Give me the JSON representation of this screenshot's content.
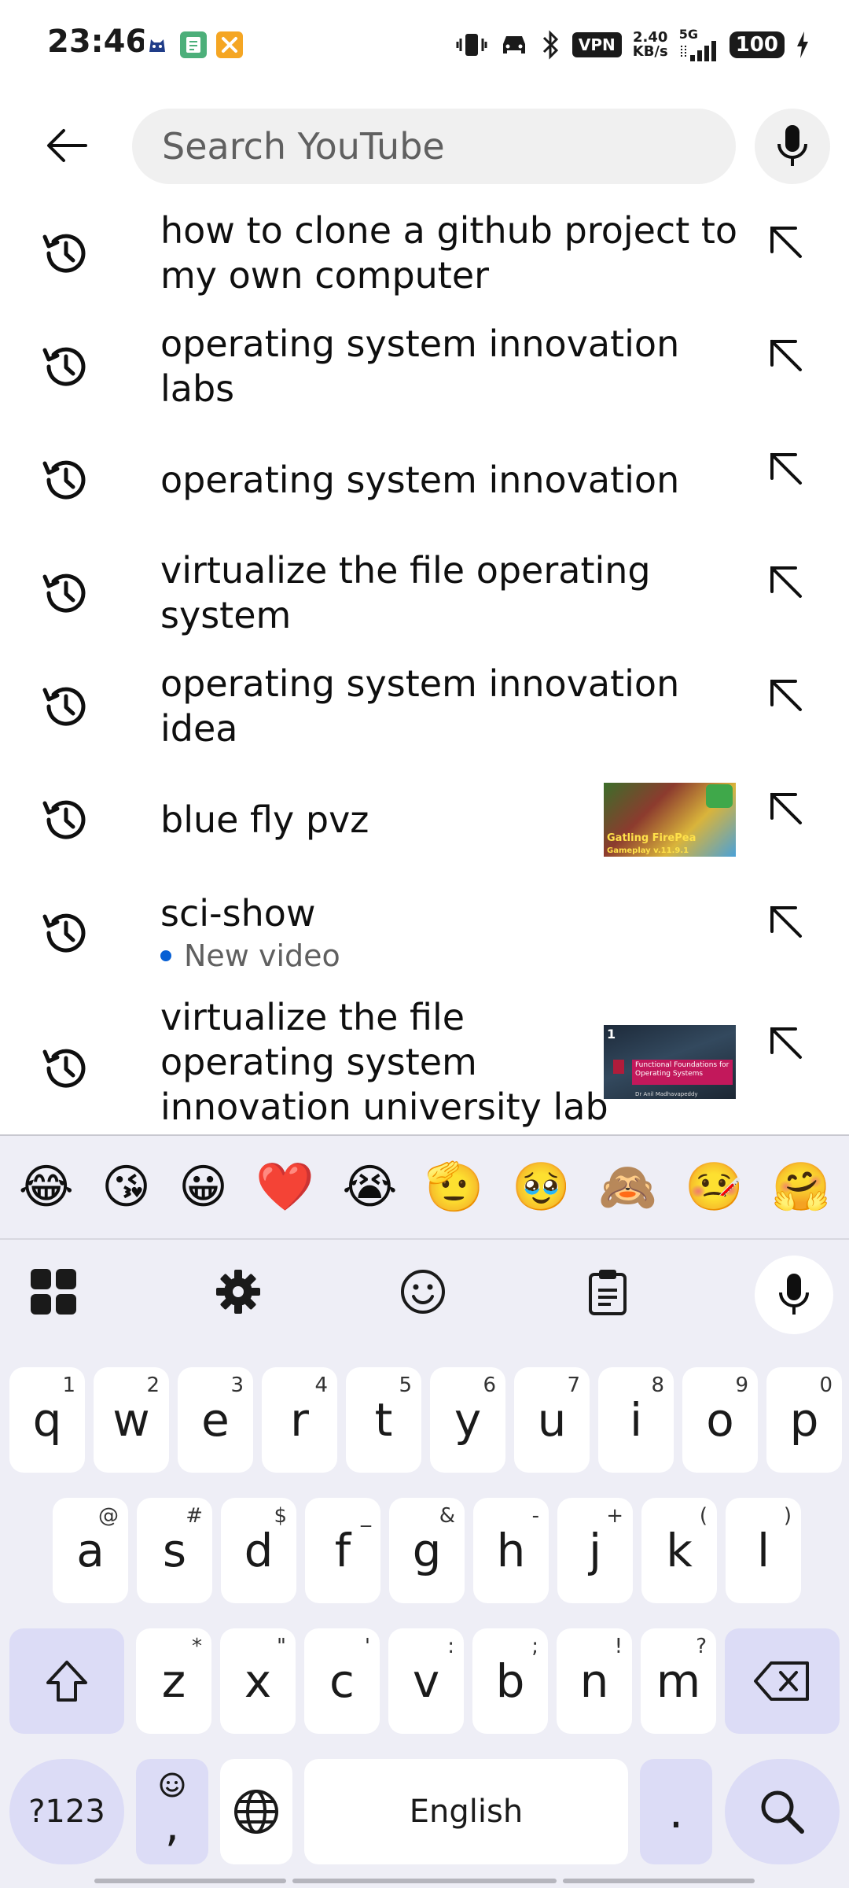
{
  "status_bar": {
    "time": "23:46",
    "vpn": "VPN",
    "speed_value": "2.40",
    "speed_unit": "KB/s",
    "network": "5G",
    "battery": "100"
  },
  "search": {
    "placeholder": "Search YouTube",
    "value": ""
  },
  "suggestions": [
    {
      "line1": "how to clone a github project to",
      "line2": "my own computer"
    },
    {
      "line1": "operating system innovation",
      "line2": "labs"
    },
    {
      "line1": "operating system innovation",
      "line2": ""
    },
    {
      "line1": "virtualize the file operating",
      "line2": "system"
    },
    {
      "line1": "operating system innovation",
      "line2": "idea"
    },
    {
      "line1": "blue fly pvz",
      "line2": "",
      "thumb_text": "Gatling FirePea",
      "thumb_sub": "Gameplay v.11.9.1"
    },
    {
      "line1": "sci-show",
      "line2": "",
      "sub_label": "New video"
    },
    {
      "line1": "virtualize the file",
      "line2": "operating system",
      "line3": "innovation university lab",
      "thumb_text": "Functional Foundations for Operating Systems",
      "thumb_sub": "Dr Anil Madhavapeddy"
    }
  ],
  "keyboard": {
    "emojis": [
      "😂",
      "😘",
      "😀",
      "❤️",
      "😭",
      "🫡",
      "🥹",
      "🙈",
      "🤒",
      "🤗"
    ],
    "row1": [
      {
        "k": "q",
        "h": "1"
      },
      {
        "k": "w",
        "h": "2"
      },
      {
        "k": "e",
        "h": "3"
      },
      {
        "k": "r",
        "h": "4"
      },
      {
        "k": "t",
        "h": "5"
      },
      {
        "k": "y",
        "h": "6"
      },
      {
        "k": "u",
        "h": "7"
      },
      {
        "k": "i",
        "h": "8"
      },
      {
        "k": "o",
        "h": "9"
      },
      {
        "k": "p",
        "h": "0"
      }
    ],
    "row2": [
      {
        "k": "a",
        "h": "@"
      },
      {
        "k": "s",
        "h": "#"
      },
      {
        "k": "d",
        "h": "$"
      },
      {
        "k": "f",
        "h": "_"
      },
      {
        "k": "g",
        "h": "&"
      },
      {
        "k": "h",
        "h": "-"
      },
      {
        "k": "j",
        "h": "+"
      },
      {
        "k": "k",
        "h": "("
      },
      {
        "k": "l",
        "h": ")"
      }
    ],
    "row3": [
      {
        "k": "z",
        "h": "*"
      },
      {
        "k": "x",
        "h": "\""
      },
      {
        "k": "c",
        "h": "'"
      },
      {
        "k": "v",
        "h": ":"
      },
      {
        "k": "b",
        "h": ";"
      },
      {
        "k": "n",
        "h": "!"
      },
      {
        "k": "m",
        "h": "?"
      }
    ],
    "symbols_label": "?123",
    "comma_label": ",",
    "space_label": "English",
    "period_label": "."
  },
  "colors": {
    "accent_blue": "#065fd4",
    "keyboard_bg": "#eeeef6",
    "mod_key": "#dcdcf6"
  }
}
